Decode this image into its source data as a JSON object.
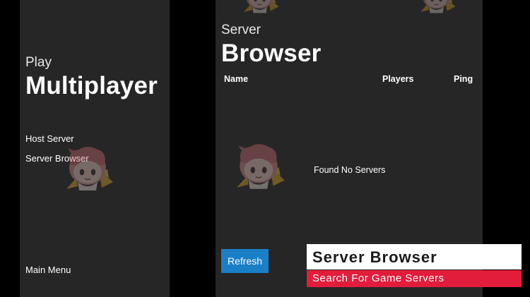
{
  "left_panel": {
    "subtitle": "Play",
    "title": "Multiplayer",
    "menu": [
      {
        "label": "Host Server"
      },
      {
        "label": "Server Browser"
      }
    ],
    "footer": "Main Menu"
  },
  "right_panel": {
    "subtitle": "Server",
    "title": "Browser",
    "columns": [
      "Name",
      "Players",
      "Ping"
    ],
    "status": "Found No Servers",
    "refresh_label": "Refresh"
  },
  "caption": {
    "title": "Server Browser",
    "subtitle": "Search For Game Servers"
  },
  "colors": {
    "background": "#000000",
    "panel": "#262626",
    "refresh_button": "#1a7fc7",
    "caption_title_bg": "#ffffff",
    "caption_sub_bg": "#e21d3c"
  },
  "icons": [
    "mascot-watermark-icon"
  ]
}
